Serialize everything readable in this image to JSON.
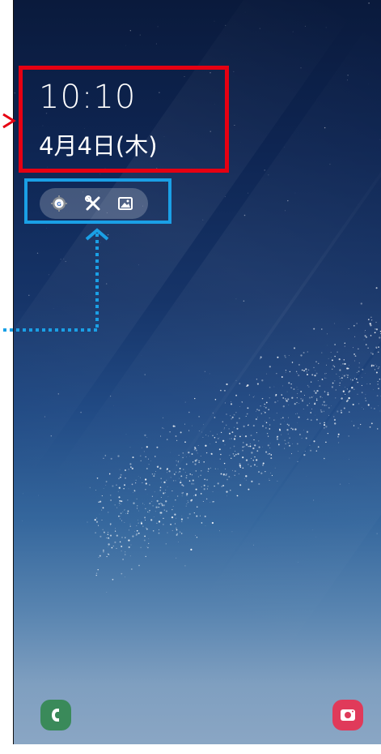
{
  "lockscreen": {
    "time": "10:10",
    "date": "4月4日(木)"
  },
  "notifications": {
    "icons": [
      "settings-google-icon",
      "tools-icon",
      "gallery-icon"
    ]
  },
  "dock": {
    "left": "phone-icon",
    "right": "camera-icon"
  },
  "colors": {
    "highlight_red": "#e60012",
    "highlight_blue": "#1aa0e6",
    "phone_icon": "#3a8a5a",
    "camera_icon": "#e03a5a"
  }
}
